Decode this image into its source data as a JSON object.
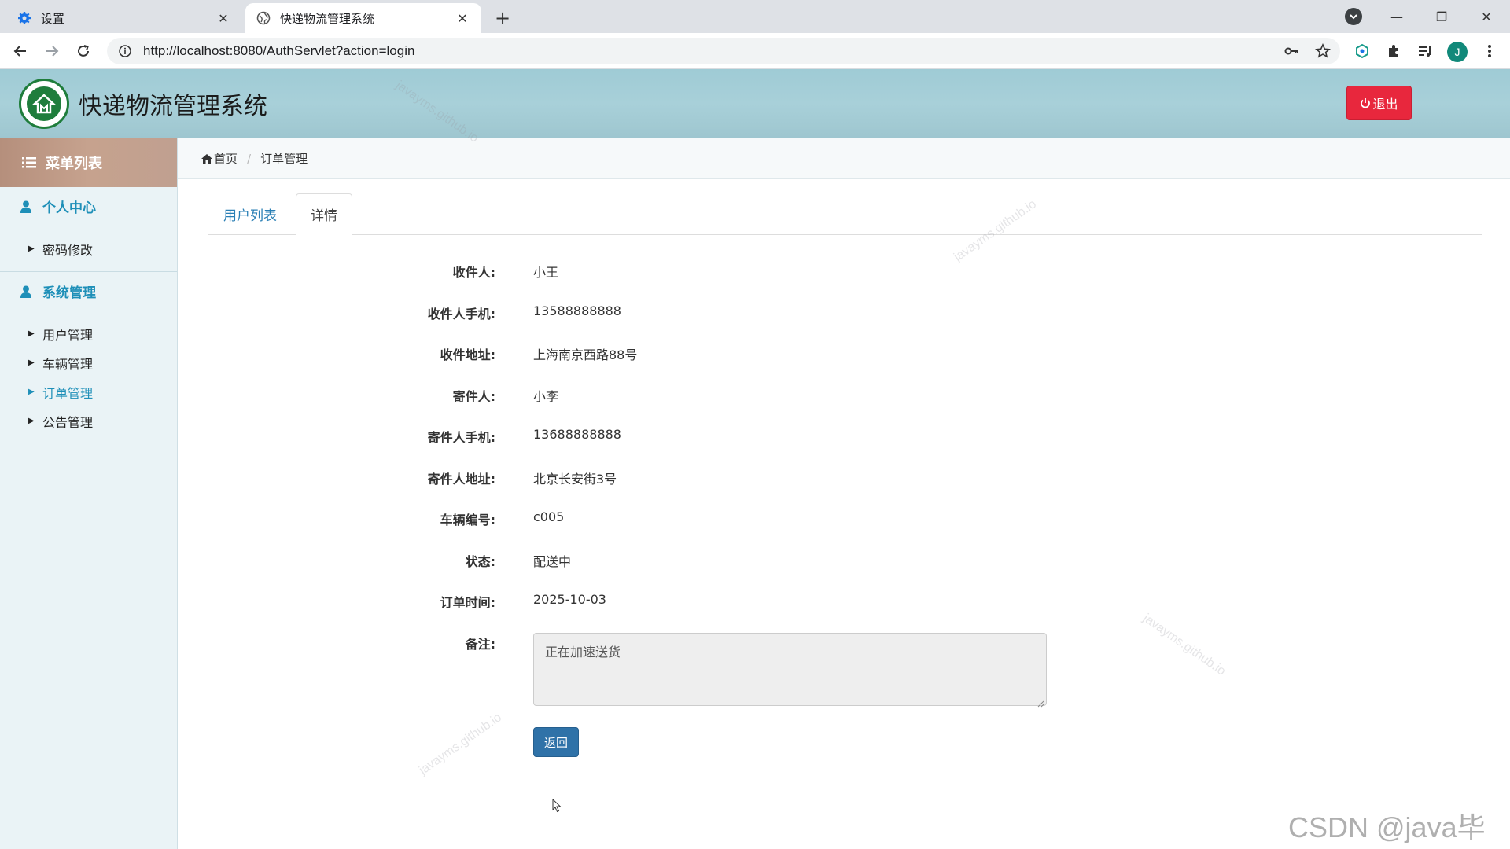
{
  "browser": {
    "tabs": [
      {
        "title": "设置",
        "active": false,
        "icon": "gear-icon"
      },
      {
        "title": "快递物流管理系统",
        "active": true,
        "icon": "globe-icon"
      }
    ],
    "url": "http://localhost:8080/AuthServlet?action=login",
    "profile_initial": "J"
  },
  "header": {
    "title": "快递物流管理系统",
    "logout_label": "退出"
  },
  "sidebar": {
    "heading": "菜单列表",
    "groups": [
      {
        "label": "个人中心",
        "items": [
          "密码修改"
        ]
      },
      {
        "label": "系统管理",
        "items": [
          "用户管理",
          "车辆管理",
          "订单管理",
          "公告管理"
        ]
      }
    ],
    "active_item": "订单管理"
  },
  "breadcrumb": {
    "home": "首页",
    "current": "订单管理"
  },
  "tabs": [
    "用户列表",
    "详情"
  ],
  "detail": {
    "fields": [
      {
        "label": "收件人:",
        "value": "小王"
      },
      {
        "label": "收件人手机:",
        "value": "13588888888"
      },
      {
        "label": "收件地址:",
        "value": "上海南京西路88号"
      },
      {
        "label": "寄件人:",
        "value": "小李"
      },
      {
        "label": "寄件人手机:",
        "value": "13688888888"
      },
      {
        "label": "寄件人地址:",
        "value": "北京长安街3号"
      },
      {
        "label": "车辆编号:",
        "value": "c005"
      },
      {
        "label": "状态:",
        "value": "配送中"
      },
      {
        "label": "订单时间:",
        "value": "2025-10-03"
      }
    ],
    "remark_label": "备注:",
    "remark_value": "正在加速送货",
    "back_label": "返回"
  },
  "watermark_text": "javayms.github.io",
  "corner_watermark": "CSDN @java毕业",
  "colors": {
    "accent": "#1e8fb8",
    "logout": "#e8273d",
    "primary_button": "#2f72a8"
  }
}
